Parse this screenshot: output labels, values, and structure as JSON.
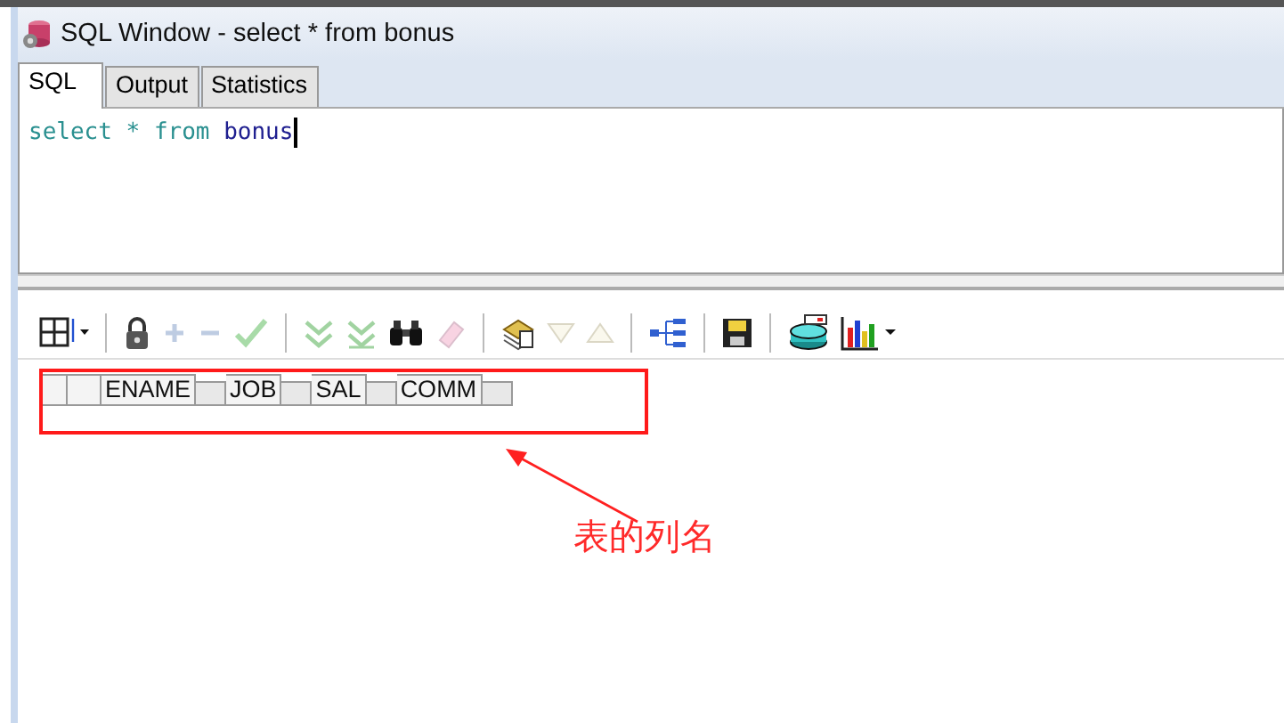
{
  "window": {
    "title": "SQL Window - select * from bonus"
  },
  "tabs": [
    {
      "label": "SQL",
      "selected": true
    },
    {
      "label": "Output",
      "selected": false
    },
    {
      "label": "Statistics",
      "selected": false
    }
  ],
  "editor": {
    "tokens": [
      {
        "text": "select * from",
        "kind": "keyword"
      },
      {
        "text": "bonus",
        "kind": "identifier"
      }
    ]
  },
  "toolbar": [
    {
      "kind": "grid",
      "disabled": false
    },
    {
      "kind": "separator"
    },
    {
      "kind": "lock",
      "disabled": false
    },
    {
      "kind": "plus",
      "disabled": true
    },
    {
      "kind": "minus",
      "disabled": true
    },
    {
      "kind": "check",
      "disabled": true
    },
    {
      "kind": "separator"
    },
    {
      "kind": "next",
      "disabled": true
    },
    {
      "kind": "last",
      "disabled": true
    },
    {
      "kind": "binoculars",
      "disabled": false
    },
    {
      "kind": "eraser",
      "disabled": true
    },
    {
      "kind": "separator"
    },
    {
      "kind": "query",
      "disabled": false
    },
    {
      "kind": "down",
      "disabled": true
    },
    {
      "kind": "up",
      "disabled": true
    },
    {
      "kind": "separator"
    },
    {
      "kind": "tree",
      "disabled": false
    },
    {
      "kind": "separator"
    },
    {
      "kind": "save",
      "disabled": false
    },
    {
      "kind": "separator"
    },
    {
      "kind": "export",
      "disabled": false
    },
    {
      "kind": "chart",
      "disabled": false
    }
  ],
  "grid": {
    "columns": [
      "ENAME",
      "JOB",
      "SAL",
      "COMM"
    ]
  },
  "annotation": {
    "text": "表的列名"
  }
}
